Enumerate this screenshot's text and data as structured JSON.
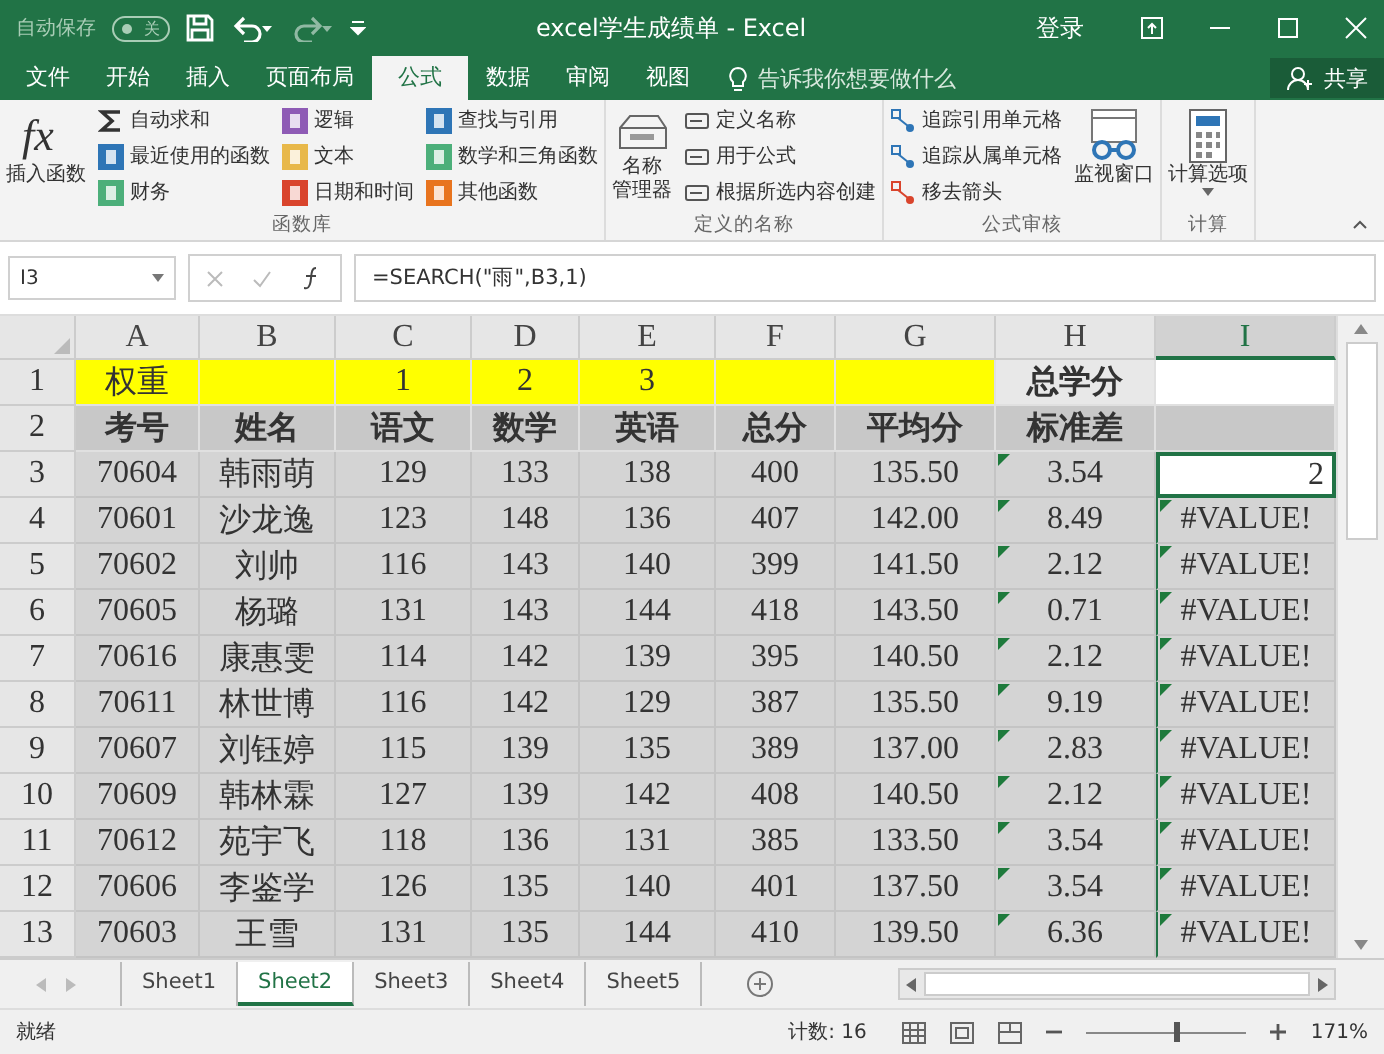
{
  "window": {
    "autosave_label": "自动保存",
    "autosave": {
      "on": false,
      "label": "关"
    },
    "title": "excel学生成绩单  -  Excel",
    "signin": "登录"
  },
  "tabs": [
    {
      "label": "文件",
      "selected": false
    },
    {
      "label": "开始",
      "selected": false
    },
    {
      "label": "插入",
      "selected": false
    },
    {
      "label": "页面布局",
      "selected": false
    },
    {
      "label": "公式",
      "selected": true
    },
    {
      "label": "数据",
      "selected": false
    },
    {
      "label": "审阅",
      "selected": false
    },
    {
      "label": "视图",
      "selected": false
    }
  ],
  "tell_me": {
    "placeholder": "告诉我你想要做什么"
  },
  "share": "共享",
  "ribbon": {
    "groups": [
      {
        "label": "函数库",
        "large": [
          {
            "kind": "fx",
            "lines": [
              "插入函数"
            ]
          }
        ],
        "columns": [
          [
            {
              "label": "自动求和",
              "kind": "sum",
              "color": "#333333"
            },
            {
              "label": "最近使用的函数",
              "kind": "square",
              "color": "#2e75b6"
            },
            {
              "label": "财务",
              "kind": "square",
              "color": "#4caf7a"
            }
          ],
          [
            {
              "label": "逻辑",
              "kind": "square",
              "color": "#8e5bb5"
            },
            {
              "label": "文本",
              "kind": "square",
              "color": "#e8b84a"
            },
            {
              "label": "日期和时间",
              "kind": "square",
              "color": "#d9442c"
            }
          ],
          [
            {
              "label": "查找与引用",
              "kind": "square",
              "color": "#2e75b6"
            },
            {
              "label": "数学和三角函数",
              "kind": "square",
              "color": "#4caf7a"
            },
            {
              "label": "其他函数",
              "kind": "square",
              "color": "#e8741e"
            }
          ]
        ]
      },
      {
        "label": "定义的名称",
        "large": [
          {
            "kind": "names",
            "lines": [
              "名称",
              "管理器"
            ]
          }
        ],
        "columns": [
          [
            {
              "label": "定义名称",
              "kind": "tag",
              "color": "#555555"
            },
            {
              "label": "用于公式",
              "kind": "tag",
              "color": "#555555"
            },
            {
              "label": "根据所选内容创建",
              "kind": "tag",
              "color": "#555555"
            }
          ]
        ]
      },
      {
        "label": "公式审核",
        "columns": [
          [
            {
              "label": "追踪引用单元格",
              "kind": "trace",
              "color": "#2e75b6"
            },
            {
              "label": "追踪从属单元格",
              "kind": "trace",
              "color": "#2e75b6"
            },
            {
              "label": "移去箭头",
              "kind": "trace",
              "color": "#d9442c"
            }
          ]
        ],
        "after": [
          {
            "kind": "watch",
            "lines": [
              "监视窗口"
            ]
          }
        ]
      },
      {
        "label": "计算",
        "large": [
          {
            "kind": "calc",
            "lines": [
              "计算选项"
            ]
          }
        ]
      }
    ]
  },
  "formula_bar": {
    "name_box": "I3",
    "formula": "=SEARCH(\"雨\",B3,1)"
  },
  "sheet": {
    "columns": [
      {
        "label": "A",
        "selected": false
      },
      {
        "label": "B",
        "selected": false
      },
      {
        "label": "C",
        "selected": false
      },
      {
        "label": "D",
        "selected": false
      },
      {
        "label": "E",
        "selected": false
      },
      {
        "label": "F",
        "selected": false
      },
      {
        "label": "G",
        "selected": false
      },
      {
        "label": "H",
        "selected": false
      },
      {
        "label": "I",
        "selected": true
      }
    ],
    "rows": [
      {
        "num": "1",
        "kind": "weight",
        "cells": [
          "权重",
          null,
          "1",
          "2",
          "3",
          null,
          null,
          "总学分",
          null
        ]
      },
      {
        "num": "2",
        "kind": "header",
        "cells": [
          "考号",
          "姓名",
          "语文",
          "数学",
          "英语",
          "总分",
          "平均分",
          "标准差",
          null
        ]
      },
      {
        "num": "3",
        "kind": "data",
        "active": true,
        "cells": [
          "70604",
          "韩雨萌",
          "129",
          "133",
          "138",
          "400",
          "135.50",
          "3.54",
          "2"
        ]
      },
      {
        "num": "4",
        "kind": "data",
        "active": false,
        "cells": [
          "70601",
          "沙龙逸",
          "123",
          "148",
          "136",
          "407",
          "142.00",
          "8.49",
          "#VALUE!"
        ]
      },
      {
        "num": "5",
        "kind": "data",
        "active": false,
        "cells": [
          "70602",
          "刘帅",
          "116",
          "143",
          "140",
          "399",
          "141.50",
          "2.12",
          "#VALUE!"
        ]
      },
      {
        "num": "6",
        "kind": "data",
        "active": false,
        "cells": [
          "70605",
          "杨璐",
          "131",
          "143",
          "144",
          "418",
          "143.50",
          "0.71",
          "#VALUE!"
        ]
      },
      {
        "num": "7",
        "kind": "data",
        "active": false,
        "cells": [
          "70616",
          "康惠雯",
          "114",
          "142",
          "139",
          "395",
          "140.50",
          "2.12",
          "#VALUE!"
        ]
      },
      {
        "num": "8",
        "kind": "data",
        "active": false,
        "cells": [
          "70611",
          "林世博",
          "116",
          "142",
          "129",
          "387",
          "135.50",
          "9.19",
          "#VALUE!"
        ]
      },
      {
        "num": "9",
        "kind": "data",
        "active": false,
        "cells": [
          "70607",
          "刘钰婷",
          "115",
          "139",
          "135",
          "389",
          "137.00",
          "2.83",
          "#VALUE!"
        ]
      },
      {
        "num": "10",
        "kind": "data",
        "active": false,
        "cells": [
          "70609",
          "韩林霖",
          "127",
          "139",
          "142",
          "408",
          "140.50",
          "2.12",
          "#VALUE!"
        ]
      },
      {
        "num": "11",
        "kind": "data",
        "active": false,
        "cells": [
          "70612",
          "苑宇飞",
          "118",
          "136",
          "131",
          "385",
          "133.50",
          "3.54",
          "#VALUE!"
        ]
      },
      {
        "num": "12",
        "kind": "data",
        "active": false,
        "cells": [
          "70606",
          "李鉴学",
          "126",
          "135",
          "140",
          "401",
          "137.50",
          "3.54",
          "#VALUE!"
        ]
      },
      {
        "num": "13",
        "kind": "data",
        "active": false,
        "cells": [
          "70603",
          "王雪",
          "131",
          "135",
          "144",
          "410",
          "139.50",
          "6.36",
          "#VALUE!"
        ]
      }
    ]
  },
  "sheet_tabs": [
    {
      "label": "Sheet1",
      "selected": false
    },
    {
      "label": "Sheet2",
      "selected": true
    },
    {
      "label": "Sheet3",
      "selected": false
    },
    {
      "label": "Sheet4",
      "selected": false
    },
    {
      "label": "Sheet5",
      "selected": false
    }
  ],
  "status_bar": {
    "mode": "就绪",
    "count": "计数: 16",
    "zoom": "171%",
    "level": 0.58
  }
}
